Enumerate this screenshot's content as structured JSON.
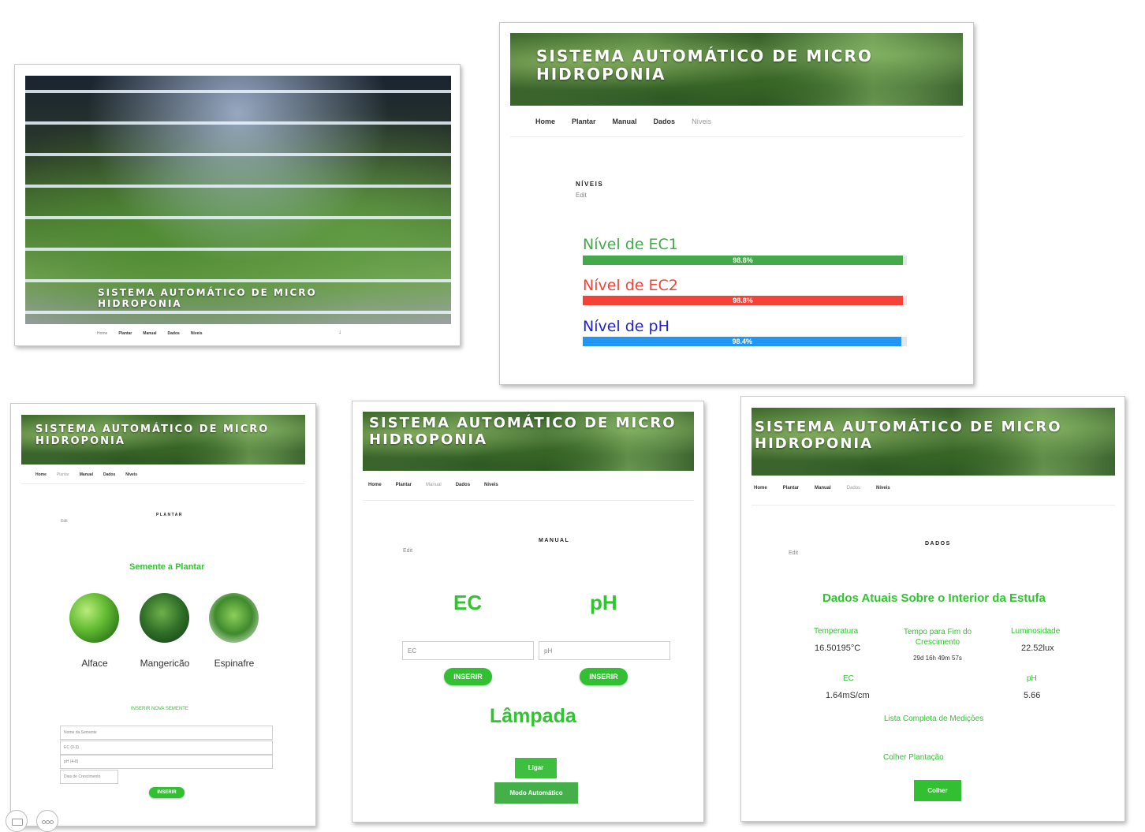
{
  "site_title": "SISTEMA AUTOMÁTICO DE MICRO\nHIDROPONIA",
  "nav": [
    "Home",
    "Plantar",
    "Manual",
    "Dados",
    "Níveis"
  ],
  "nav_down_icon": "↓",
  "edit_label": "Edit",
  "niveis": {
    "heading": "NÍVEIS",
    "bars": [
      {
        "label": "Nível de EC1",
        "value": 98.8,
        "text": "98.8%",
        "color": "#43a94b"
      },
      {
        "label": "Nível de EC2",
        "value": 98.8,
        "text": "98.8%",
        "color": "#f44336"
      },
      {
        "label": "Nível de pH",
        "value": 98.4,
        "text": "98.4%",
        "color": "#2196f3"
      }
    ]
  },
  "plantar": {
    "heading": "PLANTAR",
    "subtitle": "Semente a Plantar",
    "plants": [
      "Alface",
      "Mangericão",
      "Espinafre"
    ],
    "new_seed_title": "INSERIR NOVA SEMENTE",
    "fields": [
      "Nome da Semente",
      "EC (0-3)",
      "pH (4-8)",
      "Dias de Crescimento"
    ],
    "submit": "INSERIR"
  },
  "manual": {
    "heading": "MANUAL",
    "ec_title": "EC",
    "ph_title": "pH",
    "ec_placeholder": "EC",
    "ph_placeholder": "pH",
    "insert": "INSERIR",
    "lamp_title": "Lâmpada",
    "on_button": "Ligar",
    "auto_button": "Modo Automático"
  },
  "dados": {
    "heading": "DADOS",
    "title": "Dados Atuais Sobre o Interior da Estufa",
    "temperature_label": "Temperatura",
    "temperature_value": "16.50195°C",
    "time_label": "Tempo para Fim do\nCrescimento",
    "time_value": "29d 16h 49m 57s",
    "light_label": "Luminosidade",
    "light_value": "22.52lux",
    "ec_label": "EC",
    "ec_value": "1.64mS/cm",
    "ph_label": "pH",
    "ph_value": "5.66",
    "list_link": "Lista Completa de Medições",
    "harvest_link": "Colher Plantação",
    "harvest_button": "Colher"
  },
  "colors": {
    "accent_green": "#2fc52f",
    "button_green": "#3fbf3f"
  }
}
